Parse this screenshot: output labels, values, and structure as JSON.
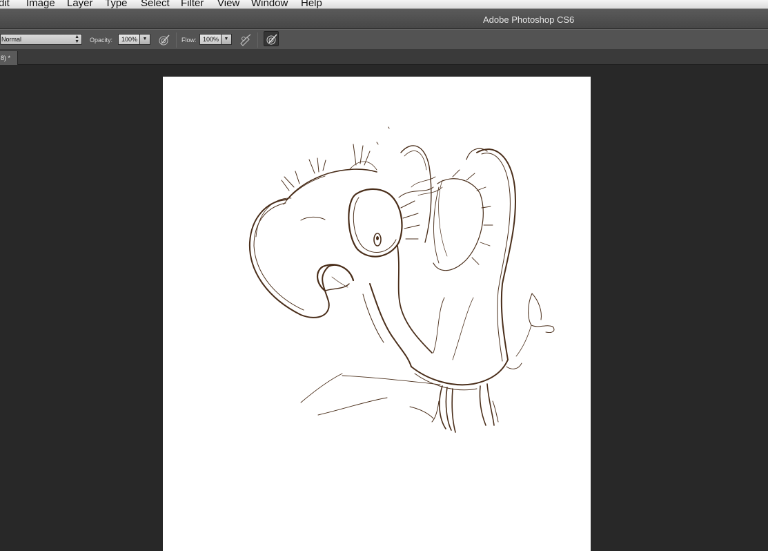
{
  "menubar": {
    "items": [
      {
        "label": "Edit",
        "display": "dit"
      },
      {
        "label": "Image"
      },
      {
        "label": "Layer"
      },
      {
        "label": "Type"
      },
      {
        "label": "Select"
      },
      {
        "label": "Filter"
      },
      {
        "label": "View"
      },
      {
        "label": "Window"
      },
      {
        "label": "Help"
      }
    ]
  },
  "titlebar": {
    "app_title": "Adobe Photoshop CS6"
  },
  "options": {
    "mode_value": "Normal",
    "opacity_label": "Opacity:",
    "opacity_value": "100%",
    "flow_label": "Flow:",
    "flow_value": "100%"
  },
  "document": {
    "tab_label": "8) *"
  },
  "canvas": {
    "background": "#ffffff",
    "stroke_color": "#4a2e1a"
  },
  "icons": {
    "mode_arrows": "updown-arrows-icon",
    "dropdown": "chevron-down-icon",
    "tablet_pressure_opacity": "pen-pressure-icon",
    "airbrush": "airbrush-icon",
    "tablet_pressure_size": "pen-pressure-icon"
  }
}
